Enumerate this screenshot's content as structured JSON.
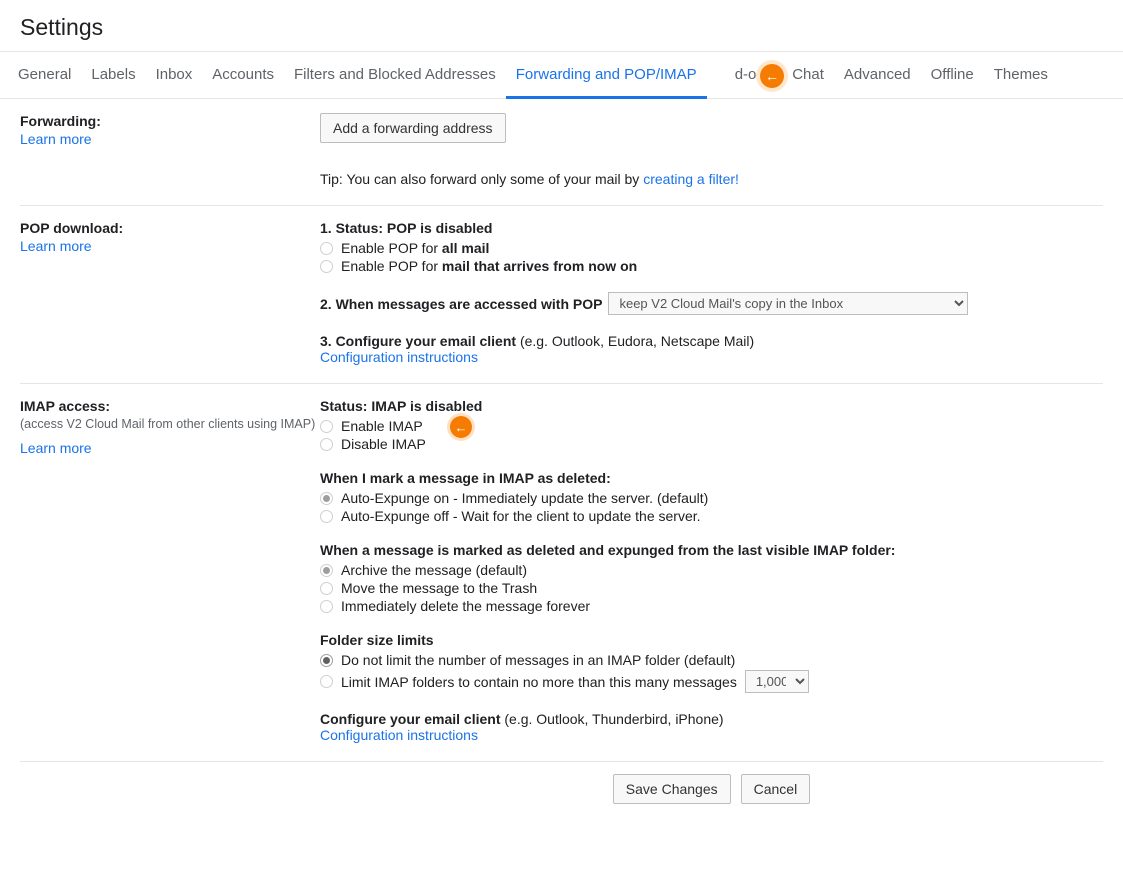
{
  "page_title": "Settings",
  "tabs": {
    "general": "General",
    "labels": "Labels",
    "inbox": "Inbox",
    "accounts": "Accounts",
    "filters": "Filters and Blocked Addresses",
    "forwarding": "Forwarding and POP/IMAP",
    "addons": "d-ons",
    "chat": "Chat",
    "advanced": "Advanced",
    "offline": "Offline",
    "themes": "Themes"
  },
  "forwarding": {
    "heading": "Forwarding:",
    "learn_more": "Learn more",
    "add_button": "Add a forwarding address",
    "tip_prefix": "Tip: You can also forward only some of your mail by ",
    "tip_link": "creating a filter!"
  },
  "pop": {
    "heading": "POP download:",
    "learn_more": "Learn more",
    "status_label": "1. Status: ",
    "status_value": "POP is disabled",
    "opt1_prefix": "Enable POP for ",
    "opt1_bold": "all mail",
    "opt2_prefix": "Enable POP for ",
    "opt2_bold": "mail that arrives from now on",
    "when_label": "2. When messages are accessed with POP",
    "when_option": "keep V2 Cloud Mail's copy in the Inbox",
    "configure_label": "3. Configure your email client ",
    "configure_hint": "(e.g. Outlook, Eudora, Netscape Mail)",
    "config_link": "Configuration instructions"
  },
  "imap": {
    "heading": "IMAP access:",
    "sub": "(access V2 Cloud Mail from other clients using IMAP)",
    "learn_more": "Learn more",
    "status_label": "Status: ",
    "status_value": "IMAP is disabled",
    "enable": "Enable IMAP",
    "disable": "Disable IMAP",
    "deleted_heading": "When I mark a message in IMAP as deleted:",
    "expunge_on": "Auto-Expunge on - Immediately update the server. (default)",
    "expunge_off": "Auto-Expunge off - Wait for the client to update the server.",
    "expunged_heading": "When a message is marked as deleted and expunged from the last visible IMAP folder:",
    "archive": "Archive the message (default)",
    "trash": "Move the message to the Trash",
    "delete_forever": "Immediately delete the message forever",
    "folder_heading": "Folder size limits",
    "folder_opt1": "Do not limit the number of messages in an IMAP folder (default)",
    "folder_opt2": "Limit IMAP folders to contain no more than this many messages",
    "folder_limit": "1,000",
    "configure_label": "Configure your email client ",
    "configure_hint": "(e.g. Outlook, Thunderbird, iPhone)",
    "config_link": "Configuration instructions"
  },
  "footer": {
    "save": "Save Changes",
    "cancel": "Cancel"
  },
  "arrow_glyph": "←"
}
